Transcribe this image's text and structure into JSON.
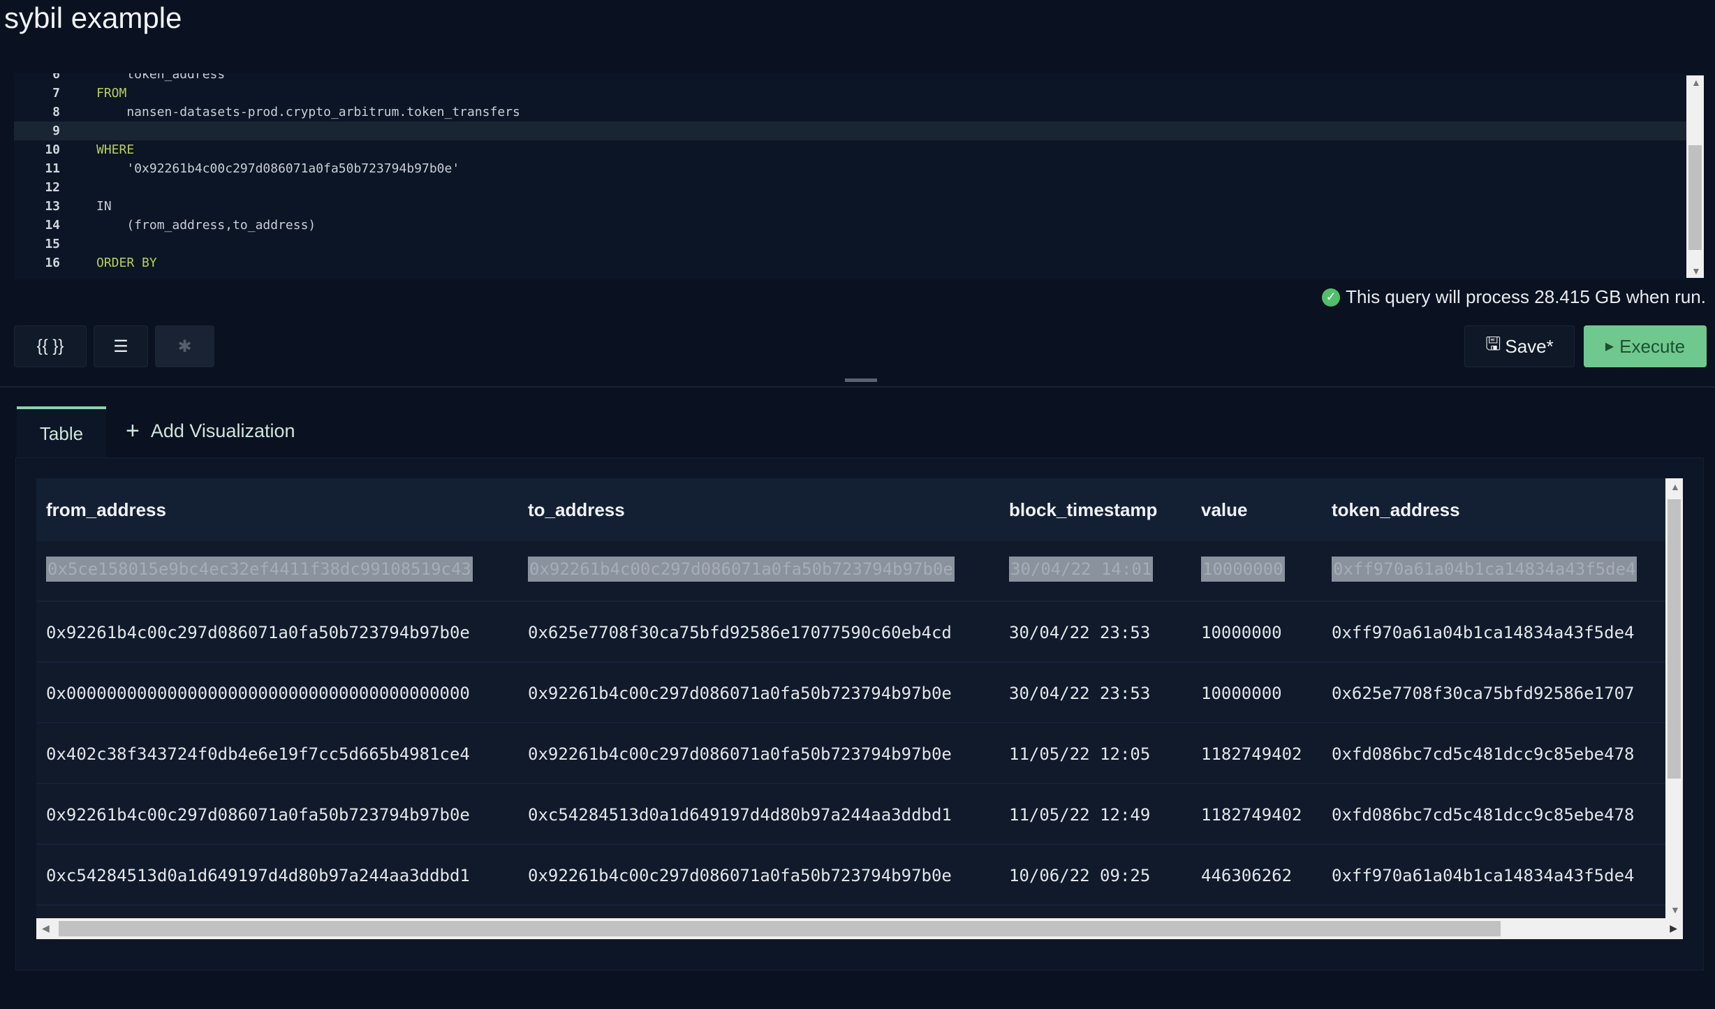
{
  "title": "sybil example",
  "editor": {
    "lines": [
      {
        "n": "6",
        "text": "    token_address",
        "kw": false
      },
      {
        "n": "7",
        "text": "FROM",
        "kw": true
      },
      {
        "n": "8",
        "text": "    nansen-datasets-prod.crypto_arbitrum.token_transfers",
        "kw": false
      },
      {
        "n": "9",
        "text": "",
        "kw": false
      },
      {
        "n": "10",
        "text": "WHERE",
        "kw": true
      },
      {
        "n": "11",
        "text": "    '0x92261b4c00c297d086071a0fa50b723794b97b0e'",
        "kw": false
      },
      {
        "n": "12",
        "text": "",
        "kw": false
      },
      {
        "n": "13",
        "text": "IN",
        "kw": false
      },
      {
        "n": "14",
        "text": "    (from_address,to_address)",
        "kw": false
      },
      {
        "n": "15",
        "text": "",
        "kw": false
      },
      {
        "n": "16",
        "text": "ORDER BY",
        "kw": true
      }
    ],
    "active_line": "9"
  },
  "status": {
    "text": "This query will process 28.415 GB when run.",
    "icon": "check-circle-icon"
  },
  "toolbar": {
    "params_label": "{{ }}",
    "format_icon": "indent-icon",
    "ai_icon": "sparkle-icon",
    "save_label": "Save*",
    "execute_label": "Execute",
    "execute_color": "#6fc98e"
  },
  "tabs": {
    "table": "Table",
    "add_viz": "Add Visualization"
  },
  "table": {
    "columns": [
      "from_address",
      "to_address",
      "block_timestamp",
      "value",
      "token_address"
    ],
    "rows": [
      [
        "0x5ce158015e9bc4ec32ef4411f38dc99108519c43",
        "0x92261b4c00c297d086071a0fa50b723794b97b0e",
        "30/04/22 14:01",
        "10000000",
        "0xff970a61a04b1ca14834a43f5de4"
      ],
      [
        "0x92261b4c00c297d086071a0fa50b723794b97b0e",
        "0x625e7708f30ca75bfd92586e17077590c60eb4cd",
        "30/04/22 23:53",
        "10000000",
        "0xff970a61a04b1ca14834a43f5de4"
      ],
      [
        "0x0000000000000000000000000000000000000000",
        "0x92261b4c00c297d086071a0fa50b723794b97b0e",
        "30/04/22 23:53",
        "10000000",
        "0x625e7708f30ca75bfd92586e1707"
      ],
      [
        "0x402c38f343724f0db4e6e19f7cc5d665b4981ce4",
        "0x92261b4c00c297d086071a0fa50b723794b97b0e",
        "11/05/22 12:05",
        "1182749402",
        "0xfd086bc7cd5c481dcc9c85ebe478"
      ],
      [
        "0x92261b4c00c297d086071a0fa50b723794b97b0e",
        "0xc54284513d0a1d649197d4d80b97a244aa3ddbd1",
        "11/05/22 12:49",
        "1182749402",
        "0xfd086bc7cd5c481dcc9c85ebe478"
      ],
      [
        "0xc54284513d0a1d649197d4d80b97a244aa3ddbd1",
        "0x92261b4c00c297d086071a0fa50b723794b97b0e",
        "10/06/22 09:25",
        "446306262",
        "0xff970a61a04b1ca14834a43f5de4"
      ]
    ],
    "selected_row": 0
  }
}
